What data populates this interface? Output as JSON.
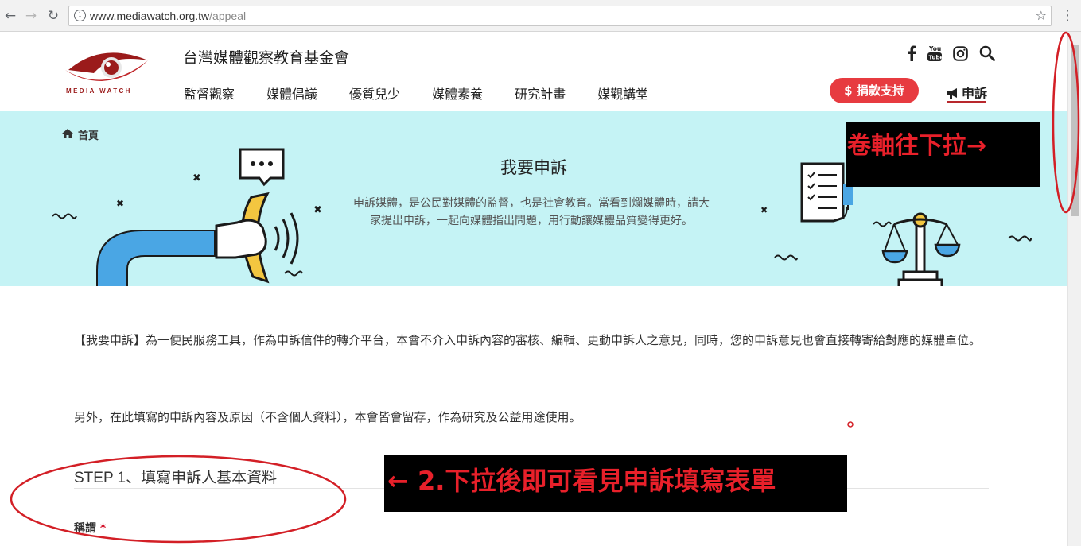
{
  "browser": {
    "back_icon": "back-arrow-icon",
    "forward_icon": "forward-arrow-icon",
    "reload_icon": "reload-icon",
    "url_host": "www.mediawatch.org.tw",
    "url_path": "/appeal",
    "bookmark_icon": "star-icon",
    "menu_icon": "vertical-dots-icon"
  },
  "header": {
    "logo_text": "MEDIA WATCH",
    "org_name": "台灣媒體觀察教育基金會",
    "nav": [
      {
        "label": "監督觀察"
      },
      {
        "label": "媒體倡議"
      },
      {
        "label": "優質兒少"
      },
      {
        "label": "媒體素養"
      },
      {
        "label": "研究計畫"
      },
      {
        "label": "媒觀講堂"
      }
    ],
    "social_icons": [
      "facebook-icon",
      "youtube-icon",
      "instagram-icon",
      "search-icon"
    ],
    "donate_label": "$ 捐款支持",
    "appeal_label": "申訴",
    "brand_red": "#e73b40"
  },
  "hero": {
    "breadcrumb": "首頁",
    "title": "我要申訴",
    "description": "申訴媒體，是公民對媒體的監督，也是社會教育。當看到爛媒體時，請大家提出申訴，一起向媒體指出問題，用行動讓媒體品質變得更好。",
    "background": "#c5f3f5"
  },
  "content": {
    "para1": "【我要申訴】為一便民服務工具，作為申訴信件的轉介平台，本會不介入申訴內容的審核、編輯、更動申訴人之意見，同時，您的申訴意見也會直接轉寄給對應的媒體單位。",
    "para2": "另外，在此填寫的申訴內容及原因（不含個人資料），本會皆會留存，作為研究及公益用途使用。",
    "step1_title": "STEP 1、填寫申訴人基本資料",
    "field1_label": "稱謂",
    "required_mark": "*"
  },
  "annotations": {
    "note_scroll": "卷軸往下拉→",
    "note_form": "← 2.下拉後即可看見申訴填寫表單",
    "color": "#e8202a"
  }
}
